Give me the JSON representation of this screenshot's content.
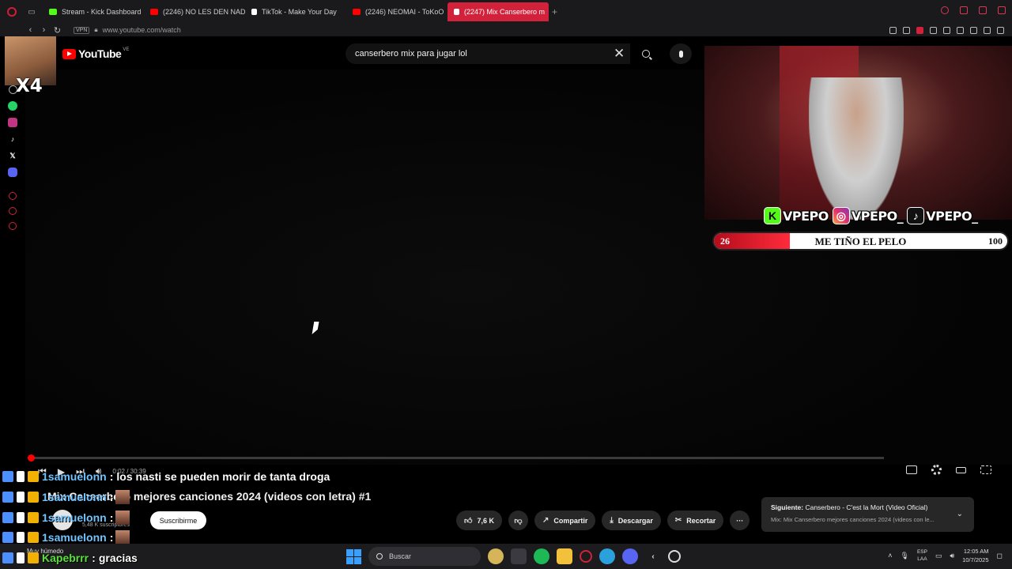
{
  "browser": {
    "tabs": [
      {
        "title": "Stream - Kick Dashboard",
        "icon_color": "#53fc18"
      },
      {
        "title": "(2246) NO LES DEN NAD",
        "icon_color": "#ff0000"
      },
      {
        "title": "TikTok - Make Your Day",
        "icon_color": "#ffffff"
      },
      {
        "title": "(2246) NEOMAI - ToKoO",
        "icon_color": "#ff0000"
      },
      {
        "title": "(2247) Mix Canserbero m",
        "icon_color": "#ffffff",
        "active": true
      }
    ],
    "new_tab": "+",
    "vpn": "VPN",
    "url": "www.youtube.com/watch"
  },
  "sidebar_icons": [
    "settings-icon",
    "whatsapp-icon",
    "instagram-icon",
    "tiktok-icon",
    "x-icon",
    "discord-icon",
    "history-icon",
    "messenger-icon",
    "circle-icon"
  ],
  "youtube": {
    "logo_text": "YouTube",
    "country": "VE",
    "search_query": "canserbero mix para jugar lol",
    "player": {
      "current_time": "0:02",
      "total_time": "30:39",
      "time_display": "0:02 / 30:39",
      "progress": 0.002
    },
    "video_title": "Mix Canserbero mejores canciones 2024 (videos con letra) #1",
    "subscribers": "5,48 K suscriptores",
    "subscribe_label": "Suscribirme",
    "actions": {
      "likes": "7,6 K",
      "share": "Compartir",
      "download": "Descargar",
      "clip": "Recortar",
      "more": "···"
    },
    "up_next": {
      "label": "Siguiente:",
      "title": "Canserbero - C'est la Mort (Video Oficial)",
      "playlist": "Mix: Mix Canserbero mejores canciones 2024 (videos con le..."
    }
  },
  "overlay": {
    "emote_label": "X4",
    "socials": [
      {
        "platform": "kick",
        "handle": "VPEPO",
        "icon": "K",
        "color": "#53fc18"
      },
      {
        "platform": "instagram",
        "handle": "VPEPO_",
        "icon": "◎",
        "color": "#e1306c"
      },
      {
        "platform": "tiktok",
        "handle": "VPEPO_",
        "icon": "♪",
        "color": "#111111"
      }
    ],
    "goal": {
      "current": "26",
      "title": "ME TIÑO EL PELO",
      "max": "100",
      "fraction": 0.26
    }
  },
  "chat": [
    {
      "user": "1samuelonn",
      "sep": ":",
      "message": "los nasti se pueden morir de tanta droga",
      "user_color": "#6fc3ff"
    },
    {
      "user": "1samuelonn",
      "sep": ":",
      "message": "",
      "user_color": "#6fc3ff"
    },
    {
      "user": "1samuelonn",
      "sep": ":",
      "message": "",
      "user_color": "#6fc3ff"
    },
    {
      "user": "1samuelonn",
      "sep": ":",
      "message": "",
      "user_color": "#6fc3ff"
    },
    {
      "user": "Kapebrrr",
      "sep": ":",
      "message": "gracias",
      "user_color": "#59e03c"
    }
  ],
  "taskbar": {
    "weather": "Muy húmedo",
    "search": "Buscar",
    "lang_top": "ESP",
    "lang_bottom": "LAA",
    "time": "12:05 AM",
    "date": "10/7/2025"
  }
}
